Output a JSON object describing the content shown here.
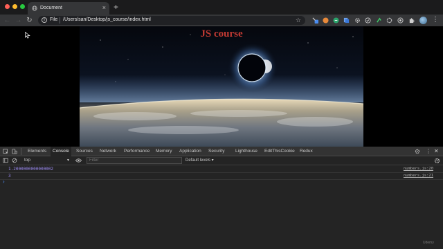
{
  "browser": {
    "tab": {
      "title": "Document"
    },
    "address": {
      "scheme": "File",
      "url": "/Users/san/Desktop/js_course/index.html"
    }
  },
  "page": {
    "heading": "JS course"
  },
  "devtools": {
    "tabs": [
      "Elements",
      "Console",
      "Sources",
      "Network",
      "Performance",
      "Memory",
      "Application",
      "Security",
      "Lighthouse",
      "EditThisCookie",
      "Redux"
    ],
    "active_tab": "Console",
    "context": "top",
    "filter_placeholder": "Filter",
    "levels": "Default levels ▾",
    "logs": [
      {
        "value": "1.2000000000000002",
        "source": "numbers.js:20"
      },
      {
        "value": "3",
        "source": "numbers.js:21"
      }
    ],
    "prompt": "›"
  },
  "watermark": "Udemy",
  "colors": {
    "heading": "#c23a33",
    "log_value": "#9d8cf5",
    "prompt": "#4f8ef7"
  }
}
